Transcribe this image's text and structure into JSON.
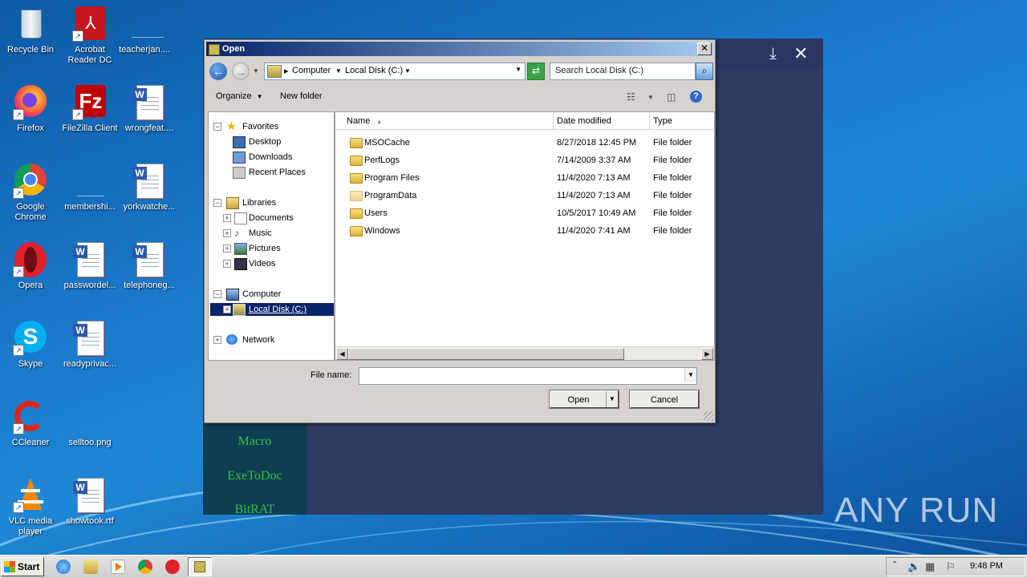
{
  "desktop": {
    "icons": [
      {
        "label": "Recycle Bin"
      },
      {
        "label": "Acrobat\nReader DC"
      },
      {
        "label": "teacherjan...."
      },
      {
        "label": "Firefox"
      },
      {
        "label": "FileZilla Client"
      },
      {
        "label": "wrongfeat...."
      },
      {
        "label": "Google\nChrome"
      },
      {
        "label": "membershi..."
      },
      {
        "label": "yorkwatche..."
      },
      {
        "label": "Opera"
      },
      {
        "label": "passwordel..."
      },
      {
        "label": "telephoneg..."
      },
      {
        "label": "Skype"
      },
      {
        "label": "readyprivac..."
      },
      {
        "label": "CCleaner"
      },
      {
        "label": "selltoo.png"
      },
      {
        "label": "VLC media\nplayer"
      },
      {
        "label": "showtook.rtf"
      }
    ]
  },
  "app": {
    "sidebar": [
      "Macro",
      "ExeToDoc",
      "BitRAT"
    ]
  },
  "dialog": {
    "title": "Open",
    "address": {
      "crumbs": [
        "Computer",
        "Local Disk (C:)"
      ]
    },
    "search_placeholder": "Search Local Disk (C:)",
    "toolbar": {
      "organize": "Organize",
      "new_folder": "New folder"
    },
    "tree": {
      "favorites": "Favorites",
      "desktop": "Desktop",
      "downloads": "Downloads",
      "recent": "Recent Places",
      "libraries": "Libraries",
      "documents": "Documents",
      "music": "Music",
      "pictures": "Pictures",
      "videos": "Videos",
      "computer": "Computer",
      "local_disk": "Local Disk (C:)",
      "network": "Network"
    },
    "columns": {
      "name": "Name",
      "date": "Date modified",
      "type": "Type"
    },
    "files": [
      {
        "name": "MSOCache",
        "date": "8/27/2018 12:45 PM",
        "type": "File folder"
      },
      {
        "name": "PerfLogs",
        "date": "7/14/2009 3:37 AM",
        "type": "File folder"
      },
      {
        "name": "Program Files",
        "date": "11/4/2020 7:13 AM",
        "type": "File folder"
      },
      {
        "name": "ProgramData",
        "date": "11/4/2020 7:13 AM",
        "type": "File folder"
      },
      {
        "name": "Users",
        "date": "10/5/2017 10:49 AM",
        "type": "File folder"
      },
      {
        "name": "Windows",
        "date": "11/4/2020 7:41 AM",
        "type": "File folder"
      }
    ],
    "file_name_label": "File name:",
    "file_name_value": "",
    "open_label": "Open",
    "cancel_label": "Cancel"
  },
  "taskbar": {
    "start_label": "Start",
    "clock": "9:48 PM"
  },
  "watermark": "ANY RUN"
}
